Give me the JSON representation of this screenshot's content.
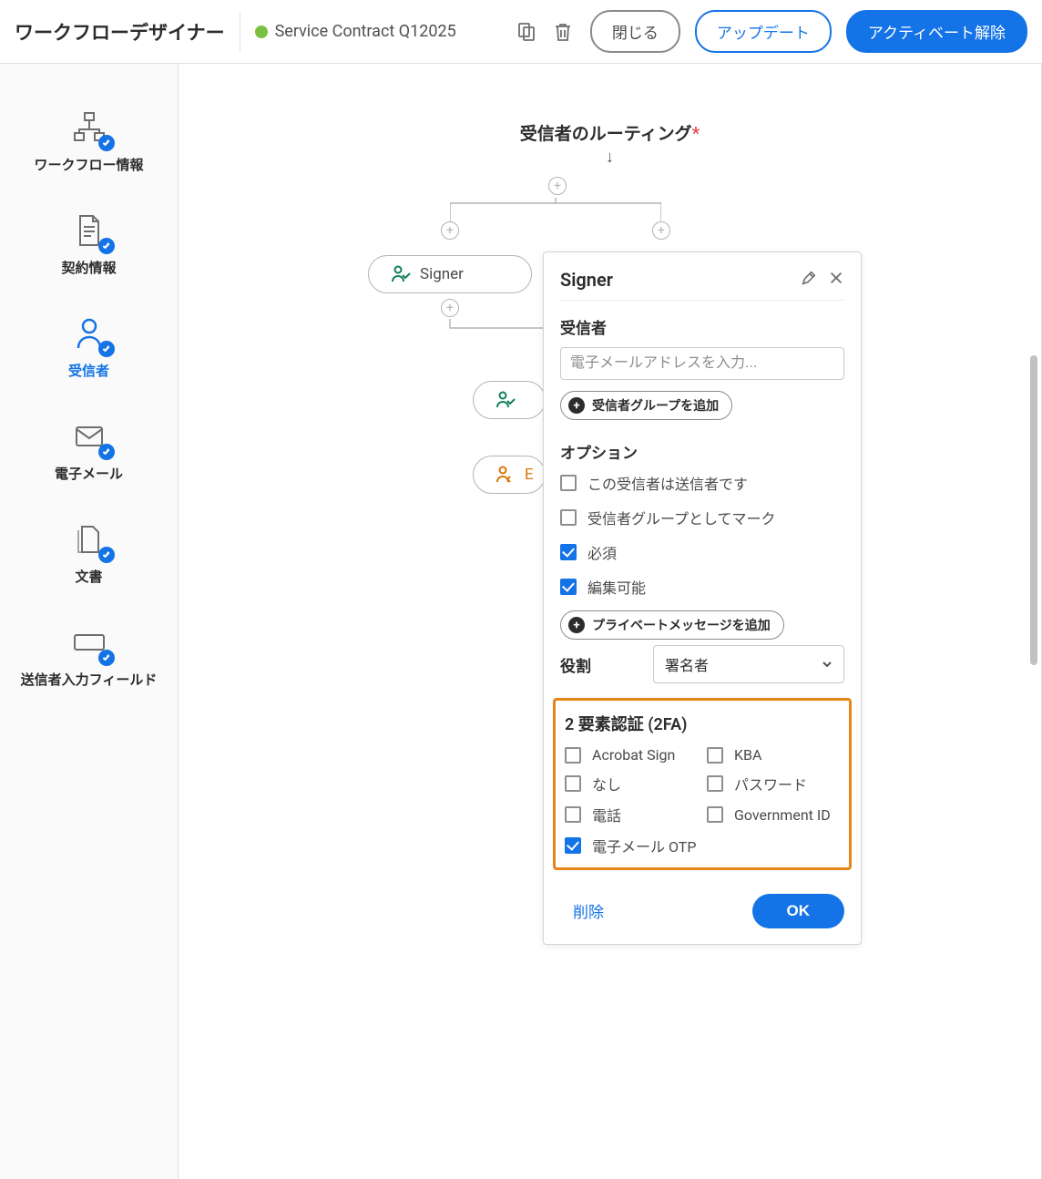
{
  "header": {
    "title": "ワークフローデザイナー",
    "status_text": "Service Contract Q12025",
    "status_color": "#7bc043",
    "btn_close": "閉じる",
    "btn_update": "アップデート",
    "btn_deactivate": "アクティベート解除"
  },
  "sidebar": {
    "items": [
      {
        "label": "ワークフロー情報",
        "name": "workflow-info"
      },
      {
        "label": "契約情報",
        "name": "agreement-info"
      },
      {
        "label": "受信者",
        "name": "recipients"
      },
      {
        "label": "電子メール",
        "name": "emails"
      },
      {
        "label": "文書",
        "name": "documents"
      },
      {
        "label": "送信者入力フィールド",
        "name": "sender-input-fields"
      }
    ],
    "active": 2
  },
  "canvas": {
    "routing_title": "受信者のルーティング",
    "nodes": {
      "signer1": "Signer",
      "signer2_truncated": "E"
    }
  },
  "panel": {
    "title": "Signer",
    "section_recipient": "受信者",
    "email_placeholder": "電子メールアドレスを入力...",
    "add_recipient_group": "受信者グループを追加",
    "section_options": "オプション",
    "options": [
      {
        "label": "この受信者は送信者です",
        "checked": false
      },
      {
        "label": "受信者グループとしてマーク",
        "checked": false
      },
      {
        "label": "必須",
        "checked": true
      },
      {
        "label": "編集可能",
        "checked": true
      }
    ],
    "add_private_msg": "プライベートメッセージを追加",
    "role_label": "役割",
    "role_value": "署名者",
    "twofa_title": "2 要素認証 (2FA)",
    "twofa": [
      {
        "label": "Acrobat Sign",
        "checked": false
      },
      {
        "label": "KBA",
        "checked": false
      },
      {
        "label": "なし",
        "checked": false
      },
      {
        "label": "パスワード",
        "checked": false
      },
      {
        "label": "電話",
        "checked": false
      },
      {
        "label": "Government ID",
        "checked": false
      },
      {
        "label": "電子メール OTP",
        "checked": true
      }
    ],
    "btn_delete": "削除",
    "btn_ok": "OK"
  }
}
